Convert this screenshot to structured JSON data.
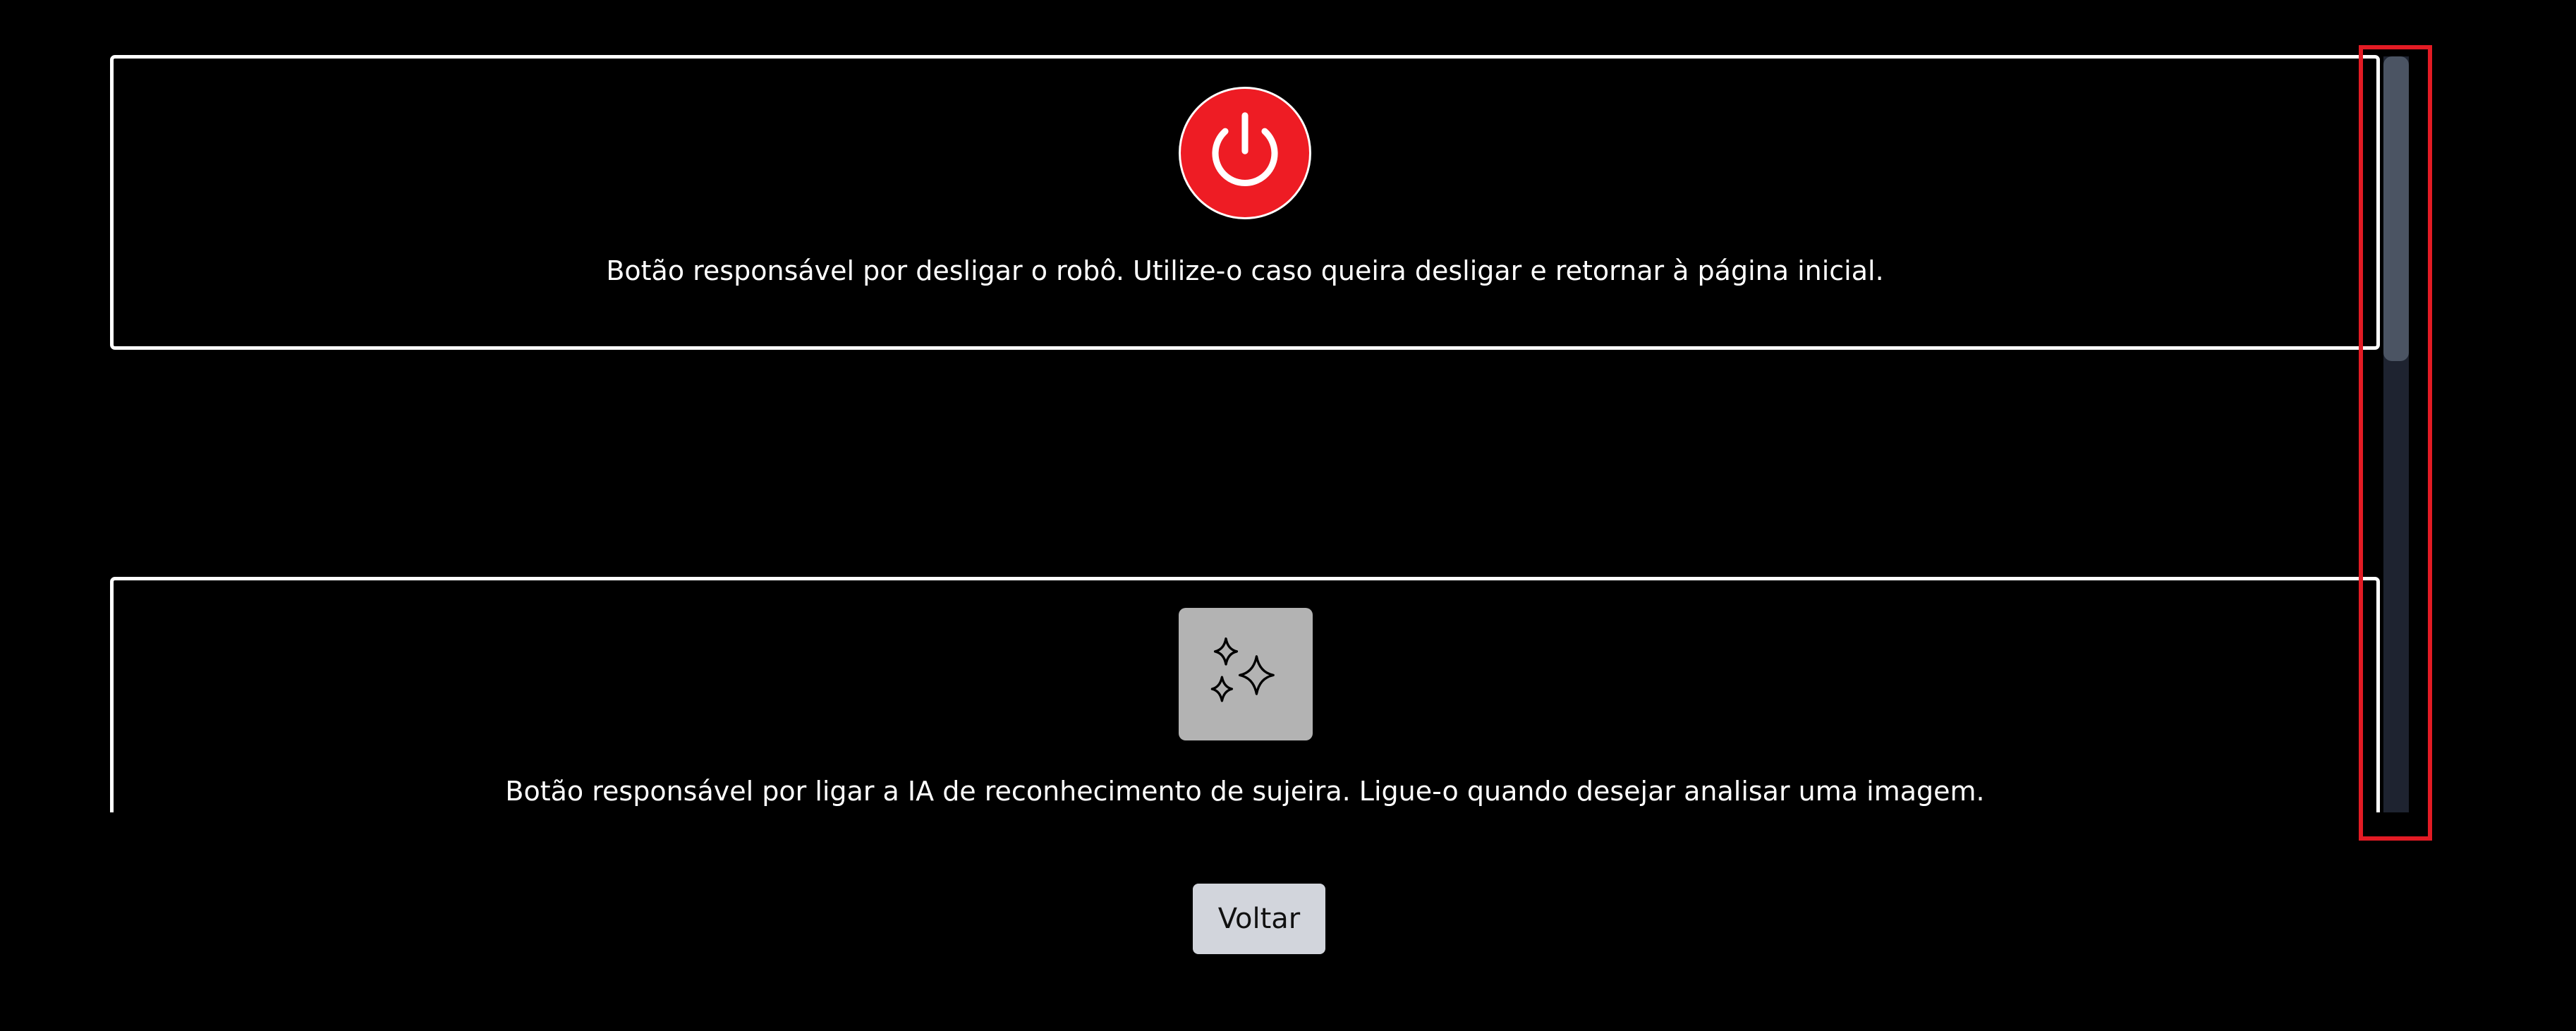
{
  "cards": [
    {
      "icon": "power-icon",
      "icon_bg": "#ee1c24",
      "description": "Botão responsável por desligar o robô. Utilize-o caso queira desligar e retornar à página inicial."
    },
    {
      "icon": "sparkles-icon",
      "icon_bg": "#b3b3b3",
      "description": "Botão responsável por ligar a IA de reconhecimento de sujeira. Ligue-o quando desejar analisar uma imagem."
    }
  ],
  "footer": {
    "back_label": "Voltar"
  },
  "scrollbar": {
    "position_fraction": 0,
    "highlight_color": "#e31b24"
  },
  "colors": {
    "background": "#000000",
    "card_border": "#ffffff",
    "button_bg": "#d2d5dc"
  }
}
